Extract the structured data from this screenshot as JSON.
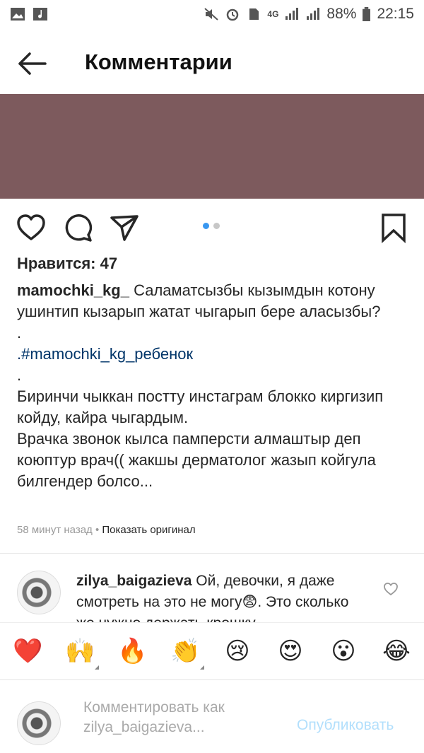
{
  "status_bar": {
    "battery": "88%",
    "time": "22:15",
    "network": "4G"
  },
  "header": {
    "title": "Комментарии"
  },
  "post": {
    "likes_text": "Нравится: 47",
    "username": "mamochki_kg_",
    "caption_line1": "Саламатсызбы кызымдын котону ушинтип кызарып жатат чыгарып бере аласызбы?",
    "dot1": ".",
    "hashtag": ".#mamochki_kg_ребенок",
    "dot2": ".",
    "caption_line2": "Биринчи чыккан постту инстаграм блокко киргизип койду, кайра чыгардым.",
    "caption_line3": "Врачка звонок кылса памперсти алмаштыр деп коюптур врач(( жакшы дерматолог жазып койгула билгендер болсо...",
    "time_ago": "58 минут назад",
    "separator": " • ",
    "show_original": "Показать оригинал"
  },
  "comment": {
    "username": "zilya_baigazieva",
    "text": "Ой, девочки, я даже смотреть на это не могу😨. Это сколько же нужно держать крошку"
  },
  "emoji_bar": {
    "emojis": [
      "❤️",
      "🙌",
      "🔥",
      "👏",
      "😢",
      "😍",
      "😮",
      "😂"
    ]
  },
  "comment_input": {
    "placeholder": "Комментировать как zilya_baigazieva...",
    "post_label": "Опубликовать"
  },
  "colors": {
    "image_placeholder": "#7d5a5d",
    "link": "#003569",
    "post_button": "#b2dffc",
    "carousel_active": "#3897f0"
  }
}
